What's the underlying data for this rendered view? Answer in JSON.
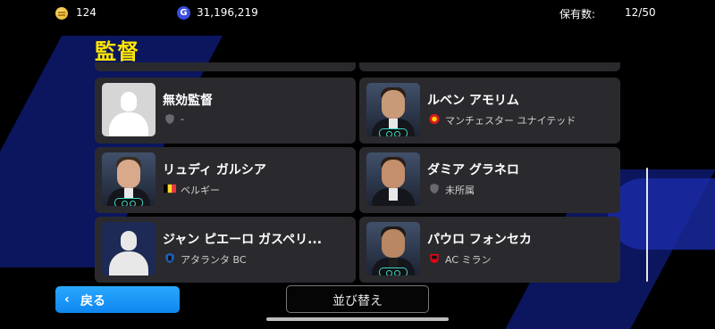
{
  "header": {
    "coins": "124",
    "gp": "31,196,219",
    "gp_icon_letter": "G",
    "owned_label": "保有数:",
    "owned_value": "12/50"
  },
  "title": "監督",
  "managers": [
    {
      "name": "無効監督",
      "sub": "-",
      "portrait": "blank-gray-silhouette",
      "sub_icon": "shield-icon"
    },
    {
      "name": "ルベン アモリム",
      "sub": "マンチェスター ユナイテッド",
      "portrait": "photo",
      "sub_icon": "club-crest-icon",
      "crest_color": "#d71920"
    },
    {
      "name": "リュディ ガルシア",
      "sub": "ベルギー",
      "portrait": "photo",
      "sub_icon": "flag-icon",
      "flag_colors": [
        "#000000",
        "#fdda24",
        "#ef3340"
      ]
    },
    {
      "name": "ダミア グラネロ",
      "sub": "未所属",
      "portrait": "photo",
      "sub_icon": "shield-icon"
    },
    {
      "name": "ジャン ピエーロ ガスペリ...",
      "sub": "アタランタ BC",
      "portrait": "blank-blue-silhouette",
      "sub_icon": "club-crest-icon",
      "crest_color": "#1e5fbf"
    },
    {
      "name": "パウロ フォンセカ",
      "sub": "AC ミラン",
      "portrait": "photo",
      "sub_icon": "club-crest-icon",
      "crest_color": "#e30613"
    }
  ],
  "footer": {
    "back_label": "戻る",
    "sort_label": "並び替え"
  },
  "colors": {
    "title": "#ffe600",
    "back_button": "#1a95f7",
    "card_bg": "#2a2a2e",
    "badge_accent": "#3bd6c6"
  }
}
